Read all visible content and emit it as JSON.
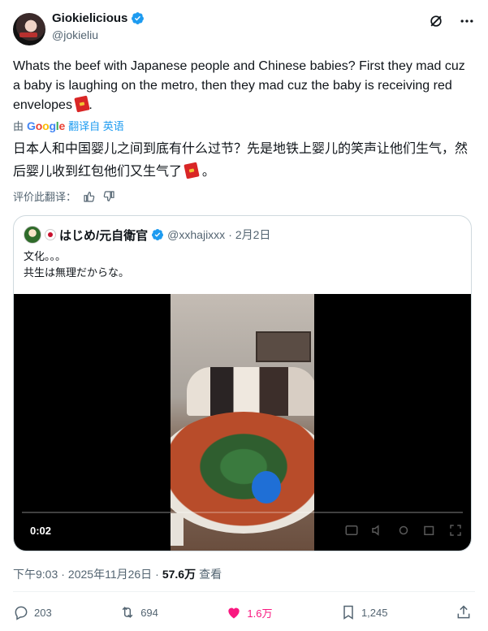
{
  "author": {
    "display_name": "Giokielicious",
    "handle": "@jokieliu"
  },
  "tweet": {
    "text": "Whats the beef with Japanese people and Chinese babies? First they mad cuz a baby is laughing on the metro, then they mad cuz the baby is receiving red envelopes",
    "trailing": ".",
    "translate_by": "由",
    "translate_provider": "Google",
    "translate_action": "翻译自 英语",
    "translated_text": "日本人和中国婴儿之间到底有什么过节？先是地铁上婴儿的笑声让他们生气，然后婴儿收到红包他们又生气了",
    "translated_trailing": "。",
    "rate_label": "评价此翻译："
  },
  "quoted": {
    "display_name": "はじめ/元自衛官",
    "handle": "@xxhajixxx",
    "separator": "·",
    "date": "2月2日",
    "line1": "文化。。。",
    "line2": "共生は無理だからな。",
    "video_time": "0:02"
  },
  "meta": {
    "time": "下午9:03",
    "sep1": "·",
    "date": "2025年11月26日",
    "sep2": "·",
    "views": "57.6万",
    "views_label": "查看"
  },
  "actions": {
    "replies": "203",
    "reposts": "694",
    "likes": "1.6万",
    "bookmarks": "1,245"
  },
  "colors": {
    "accent": "#1d9bf0",
    "like": "#f91880",
    "muted": "#536471",
    "text": "#0f1419"
  }
}
